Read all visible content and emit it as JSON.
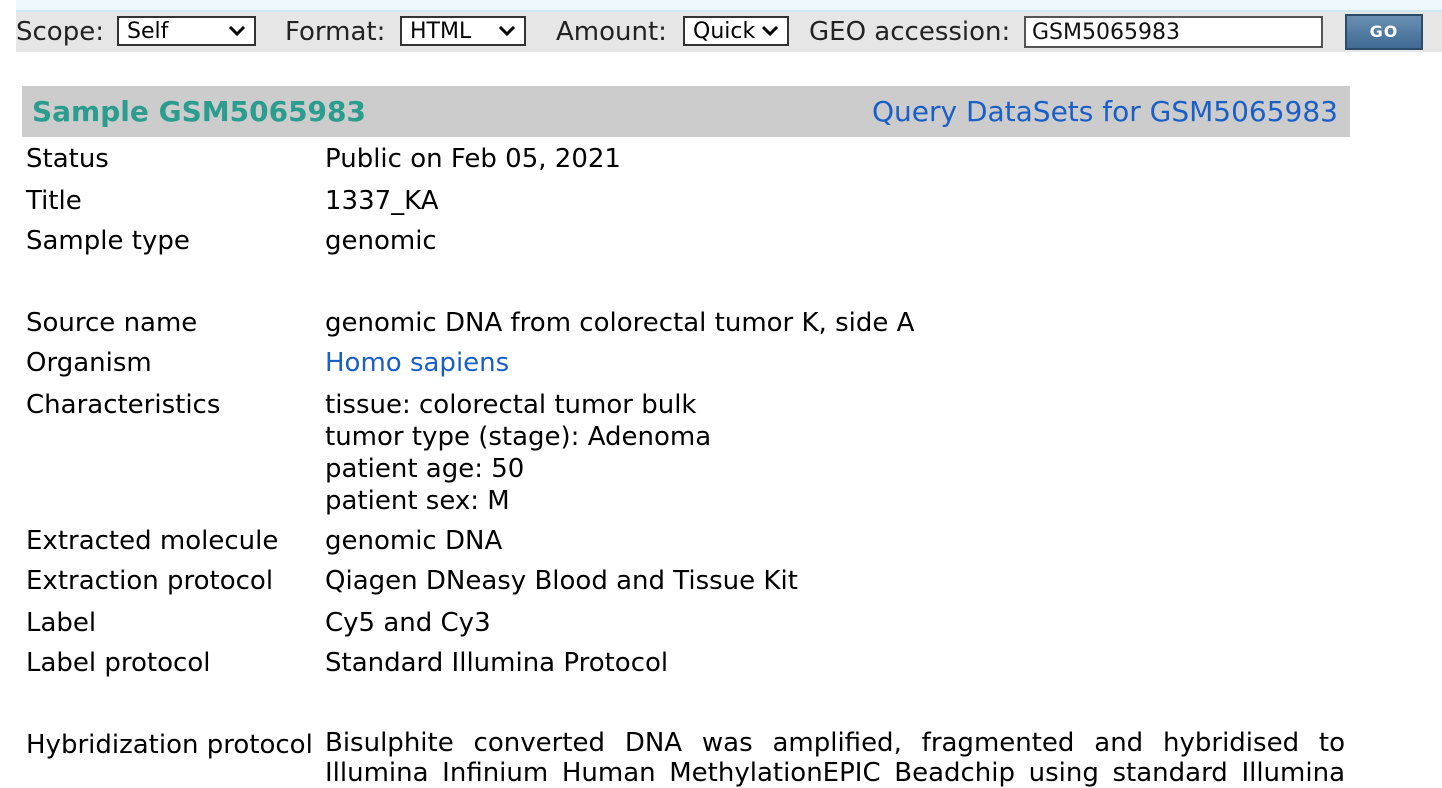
{
  "search": {
    "scope_label": "Scope:",
    "scope_value": "Self",
    "format_label": "Format:",
    "format_value": "HTML",
    "amount_label": "Amount:",
    "amount_value": "Quick",
    "accession_label": "GEO accession:",
    "accession_value": "GSM5065983",
    "go_label": "GO"
  },
  "sample": {
    "title": "Sample GSM5065983",
    "query_link": "Query DataSets for GSM5065983"
  },
  "fields": {
    "status": {
      "label": "Status",
      "value": "Public on Feb 05, 2021"
    },
    "title": {
      "label": "Title",
      "value": "1337_KA"
    },
    "sample_type": {
      "label": "Sample type",
      "value": "genomic"
    },
    "source_name": {
      "label": "Source name",
      "value": "genomic DNA from colorectal tumor K, side A"
    },
    "organism": {
      "label": "Organism",
      "value": "Homo sapiens"
    },
    "characteristics": {
      "label": "Characteristics",
      "values": [
        "tissue: colorectal tumor bulk",
        "tumor type (stage): Adenoma",
        "patient age: 50",
        "patient sex: M"
      ]
    },
    "extracted_molecule": {
      "label": "Extracted molecule",
      "value": "genomic DNA"
    },
    "extraction_protocol": {
      "label": "Extraction protocol",
      "value": "Qiagen DNeasy Blood and Tissue Kit"
    },
    "label": {
      "label": "Label",
      "value": "Cy5 and Cy3"
    },
    "label_protocol": {
      "label": "Label protocol",
      "value": "Standard Illumina Protocol"
    },
    "hybridization_protocol": {
      "label": "Hybridization protocol",
      "lines": [
        "Bisulphite converted DNA was amplified, fragmented and hybridised to",
        "Illumina Infinium Human MethylationEPIC Beadchip using standard Illumina"
      ]
    }
  },
  "colors": {
    "header_bg": "#cccccc",
    "title_color": "#2a9d8f",
    "link_color": "#1a5fc7"
  },
  "icons": [
    "chevron-down-icon"
  ]
}
